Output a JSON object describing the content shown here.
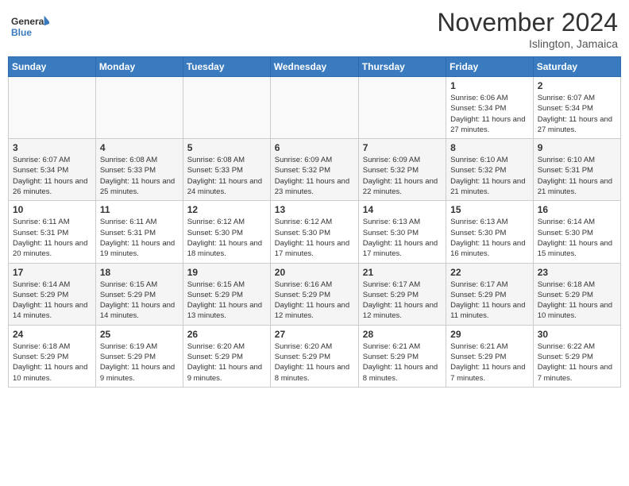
{
  "header": {
    "logo_general": "General",
    "logo_blue": "Blue",
    "month_title": "November 2024",
    "location": "Islington, Jamaica"
  },
  "weekdays": [
    "Sunday",
    "Monday",
    "Tuesday",
    "Wednesday",
    "Thursday",
    "Friday",
    "Saturday"
  ],
  "weeks": [
    [
      {
        "day": "",
        "info": ""
      },
      {
        "day": "",
        "info": ""
      },
      {
        "day": "",
        "info": ""
      },
      {
        "day": "",
        "info": ""
      },
      {
        "day": "",
        "info": ""
      },
      {
        "day": "1",
        "info": "Sunrise: 6:06 AM\nSunset: 5:34 PM\nDaylight: 11 hours and 27 minutes."
      },
      {
        "day": "2",
        "info": "Sunrise: 6:07 AM\nSunset: 5:34 PM\nDaylight: 11 hours and 27 minutes."
      }
    ],
    [
      {
        "day": "3",
        "info": "Sunrise: 6:07 AM\nSunset: 5:34 PM\nDaylight: 11 hours and 26 minutes."
      },
      {
        "day": "4",
        "info": "Sunrise: 6:08 AM\nSunset: 5:33 PM\nDaylight: 11 hours and 25 minutes."
      },
      {
        "day": "5",
        "info": "Sunrise: 6:08 AM\nSunset: 5:33 PM\nDaylight: 11 hours and 24 minutes."
      },
      {
        "day": "6",
        "info": "Sunrise: 6:09 AM\nSunset: 5:32 PM\nDaylight: 11 hours and 23 minutes."
      },
      {
        "day": "7",
        "info": "Sunrise: 6:09 AM\nSunset: 5:32 PM\nDaylight: 11 hours and 22 minutes."
      },
      {
        "day": "8",
        "info": "Sunrise: 6:10 AM\nSunset: 5:32 PM\nDaylight: 11 hours and 21 minutes."
      },
      {
        "day": "9",
        "info": "Sunrise: 6:10 AM\nSunset: 5:31 PM\nDaylight: 11 hours and 21 minutes."
      }
    ],
    [
      {
        "day": "10",
        "info": "Sunrise: 6:11 AM\nSunset: 5:31 PM\nDaylight: 11 hours and 20 minutes."
      },
      {
        "day": "11",
        "info": "Sunrise: 6:11 AM\nSunset: 5:31 PM\nDaylight: 11 hours and 19 minutes."
      },
      {
        "day": "12",
        "info": "Sunrise: 6:12 AM\nSunset: 5:30 PM\nDaylight: 11 hours and 18 minutes."
      },
      {
        "day": "13",
        "info": "Sunrise: 6:12 AM\nSunset: 5:30 PM\nDaylight: 11 hours and 17 minutes."
      },
      {
        "day": "14",
        "info": "Sunrise: 6:13 AM\nSunset: 5:30 PM\nDaylight: 11 hours and 17 minutes."
      },
      {
        "day": "15",
        "info": "Sunrise: 6:13 AM\nSunset: 5:30 PM\nDaylight: 11 hours and 16 minutes."
      },
      {
        "day": "16",
        "info": "Sunrise: 6:14 AM\nSunset: 5:30 PM\nDaylight: 11 hours and 15 minutes."
      }
    ],
    [
      {
        "day": "17",
        "info": "Sunrise: 6:14 AM\nSunset: 5:29 PM\nDaylight: 11 hours and 14 minutes."
      },
      {
        "day": "18",
        "info": "Sunrise: 6:15 AM\nSunset: 5:29 PM\nDaylight: 11 hours and 14 minutes."
      },
      {
        "day": "19",
        "info": "Sunrise: 6:15 AM\nSunset: 5:29 PM\nDaylight: 11 hours and 13 minutes."
      },
      {
        "day": "20",
        "info": "Sunrise: 6:16 AM\nSunset: 5:29 PM\nDaylight: 11 hours and 12 minutes."
      },
      {
        "day": "21",
        "info": "Sunrise: 6:17 AM\nSunset: 5:29 PM\nDaylight: 11 hours and 12 minutes."
      },
      {
        "day": "22",
        "info": "Sunrise: 6:17 AM\nSunset: 5:29 PM\nDaylight: 11 hours and 11 minutes."
      },
      {
        "day": "23",
        "info": "Sunrise: 6:18 AM\nSunset: 5:29 PM\nDaylight: 11 hours and 10 minutes."
      }
    ],
    [
      {
        "day": "24",
        "info": "Sunrise: 6:18 AM\nSunset: 5:29 PM\nDaylight: 11 hours and 10 minutes."
      },
      {
        "day": "25",
        "info": "Sunrise: 6:19 AM\nSunset: 5:29 PM\nDaylight: 11 hours and 9 minutes."
      },
      {
        "day": "26",
        "info": "Sunrise: 6:20 AM\nSunset: 5:29 PM\nDaylight: 11 hours and 9 minutes."
      },
      {
        "day": "27",
        "info": "Sunrise: 6:20 AM\nSunset: 5:29 PM\nDaylight: 11 hours and 8 minutes."
      },
      {
        "day": "28",
        "info": "Sunrise: 6:21 AM\nSunset: 5:29 PM\nDaylight: 11 hours and 8 minutes."
      },
      {
        "day": "29",
        "info": "Sunrise: 6:21 AM\nSunset: 5:29 PM\nDaylight: 11 hours and 7 minutes."
      },
      {
        "day": "30",
        "info": "Sunrise: 6:22 AM\nSunset: 5:29 PM\nDaylight: 11 hours and 7 minutes."
      }
    ]
  ]
}
